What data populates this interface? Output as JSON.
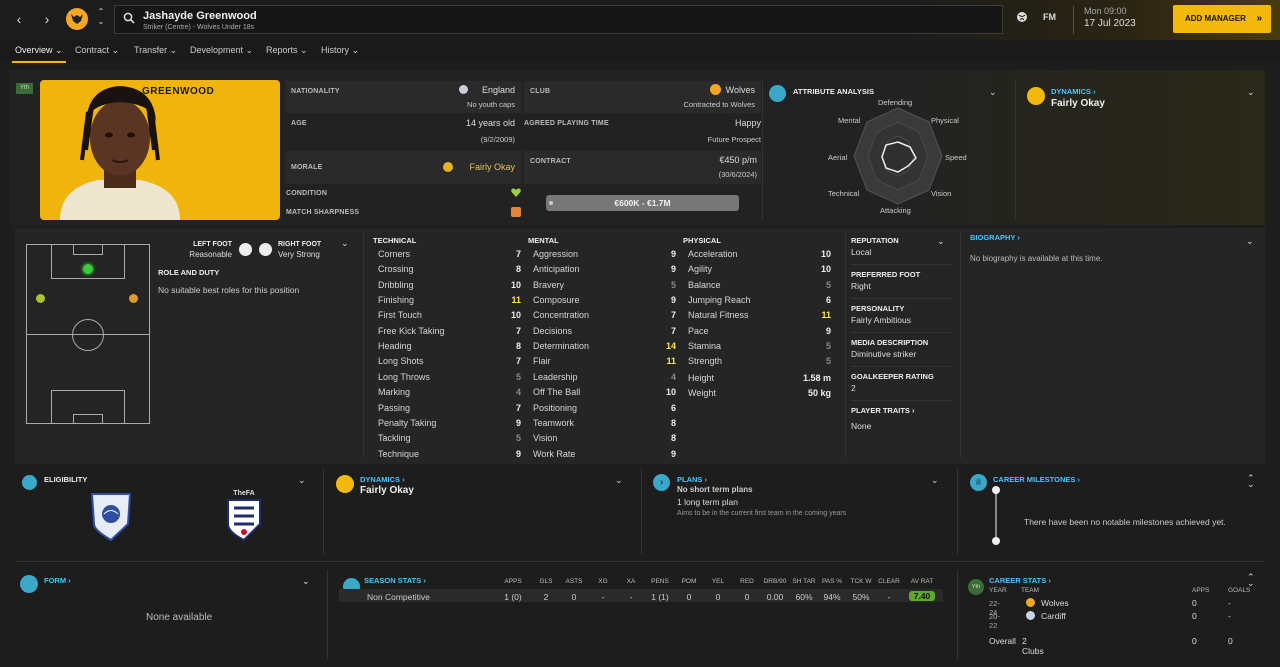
{
  "header": {
    "player_name": "Jashayde Greenwood",
    "player_sub": "Striker (Centre) - Wolves Under 18s",
    "fm_label": "FM",
    "date_time": "Mon 09:00",
    "date": "17 Jul 2023",
    "add_manager": "ADD MANAGER"
  },
  "tabs": [
    {
      "label": "Overview ⌄"
    },
    {
      "label": "Contract ⌄"
    },
    {
      "label": "Transfer ⌄"
    },
    {
      "label": "Development ⌄"
    },
    {
      "label": "Reports ⌄"
    },
    {
      "label": "History ⌄"
    }
  ],
  "profile": {
    "badge": "Yth",
    "surname": "GREENWOOD",
    "nationality_label": "NATIONALITY",
    "nationality": "England",
    "youth_caps": "No youth caps",
    "age_label": "AGE",
    "age": "14 years old",
    "dob": "(9/2/2009)",
    "morale_label": "MORALE",
    "morale": "Fairly Okay",
    "club_label": "CLUB",
    "club": "Wolves",
    "contracted": "Contracted to Wolves",
    "apt_label": "AGREED PLAYING TIME",
    "apt": "Happy",
    "apt_sub": "Future Prospect",
    "contract_label": "CONTRACT",
    "wage": "€450 p/m",
    "contract_end": "(30/6/2024)",
    "condition_label": "CONDITION",
    "sharpness_label": "MATCH SHARPNESS",
    "value": "€600K - €1.7M"
  },
  "attr_analysis": {
    "title": "ATTRIBUTE ANALYSIS",
    "labels": [
      "Defending",
      "Physical",
      "Speed",
      "Vision",
      "Attacking",
      "Technical",
      "Aerial",
      "Mental"
    ]
  },
  "dynamics_top": {
    "title": "DYNAMICS",
    "value": "Fairly Okay"
  },
  "pitch": {
    "left_foot_label": "LEFT FOOT",
    "left_foot": "Reasonable",
    "right_foot_label": "RIGHT FOOT",
    "right_foot": "Very Strong",
    "role_title": "ROLE AND DUTY",
    "role_text": "No suitable best roles for this position"
  },
  "technical": {
    "title": "TECHNICAL",
    "rows": [
      [
        "Corners",
        "7",
        "w"
      ],
      [
        "Crossing",
        "8",
        "w"
      ],
      [
        "Dribbling",
        "10",
        "w"
      ],
      [
        "Finishing",
        "11",
        "y"
      ],
      [
        "First Touch",
        "10",
        "w"
      ],
      [
        "Free Kick Taking",
        "7",
        "w"
      ],
      [
        "Heading",
        "8",
        "w"
      ],
      [
        "Long Shots",
        "7",
        "w"
      ],
      [
        "Long Throws",
        "5",
        "d"
      ],
      [
        "Marking",
        "4",
        "d"
      ],
      [
        "Passing",
        "7",
        "w"
      ],
      [
        "Penalty Taking",
        "9",
        "w"
      ],
      [
        "Tackling",
        "5",
        "d"
      ],
      [
        "Technique",
        "9",
        "w"
      ]
    ]
  },
  "mental": {
    "title": "MENTAL",
    "rows": [
      [
        "Aggression",
        "9",
        "w"
      ],
      [
        "Anticipation",
        "9",
        "w"
      ],
      [
        "Bravery",
        "5",
        "d"
      ],
      [
        "Composure",
        "9",
        "w"
      ],
      [
        "Concentration",
        "7",
        "w"
      ],
      [
        "Decisions",
        "7",
        "w"
      ],
      [
        "Determination",
        "14",
        "y"
      ],
      [
        "Flair",
        "11",
        "y"
      ],
      [
        "Leadership",
        "4",
        "d"
      ],
      [
        "Off The Ball",
        "10",
        "w"
      ],
      [
        "Positioning",
        "6",
        "w"
      ],
      [
        "Teamwork",
        "8",
        "w"
      ],
      [
        "Vision",
        "8",
        "w"
      ],
      [
        "Work Rate",
        "9",
        "w"
      ]
    ]
  },
  "physical": {
    "title": "PHYSICAL",
    "rows": [
      [
        "Acceleration",
        "10",
        "w"
      ],
      [
        "Agility",
        "10",
        "w"
      ],
      [
        "Balance",
        "5",
        "d"
      ],
      [
        "Jumping Reach",
        "6",
        "w"
      ],
      [
        "Natural Fitness",
        "11",
        "y"
      ],
      [
        "Pace",
        "9",
        "w"
      ],
      [
        "Stamina",
        "5",
        "d"
      ],
      [
        "Strength",
        "5",
        "d"
      ]
    ],
    "height_label": "Height",
    "height": "1.58 m",
    "weight_label": "Weight",
    "weight": "50 kg"
  },
  "info": {
    "reputation_label": "REPUTATION",
    "reputation": "Local",
    "pref_foot_label": "PREFERRED FOOT",
    "pref_foot": "Right",
    "personality_label": "PERSONALITY",
    "personality": "Fairly Ambitious",
    "media_label": "MEDIA DESCRIPTION",
    "media": "Diminutive striker",
    "gk_label": "GOALKEEPER RATING",
    "gk": "2",
    "traits_label": "PLAYER TRAITS",
    "traits": "None"
  },
  "biography": {
    "title": "BIOGRAPHY",
    "text": "No biography is available at this time."
  },
  "eligibility": {
    "title": "ELIGIBILITY",
    "fa_text": "TheFA"
  },
  "dynamics_mid": {
    "title": "DYNAMICS",
    "value": "Fairly Okay"
  },
  "plans": {
    "title": "PLANS",
    "short": "No short term plans",
    "long": "1 long term plan",
    "long_sub": "Aims to be in the current first team in the coming years"
  },
  "milestones": {
    "title": "CAREER MILESTONES",
    "text": "There have been no notable milestones achieved yet."
  },
  "form": {
    "title": "FORM",
    "text": "None available"
  },
  "season": {
    "title": "SEASON STATS",
    "headers": [
      "APPS",
      "GLS",
      "ASTS",
      "XG",
      "XA",
      "PENS",
      "POM",
      "YEL",
      "RED",
      "DRB/90",
      "SH TAR",
      "PAS %",
      "TCK W",
      "CLEAR",
      "AV RAT"
    ],
    "row_label": "Non Competitive",
    "values": [
      "1 (0)",
      "2",
      "0",
      "-",
      "-",
      "1 (1)",
      "0",
      "0",
      "0",
      "0.00",
      "60%",
      "94%",
      "50%",
      "-",
      "7.40"
    ]
  },
  "career": {
    "title": "CAREER STATS",
    "badge": "Yth",
    "col_year": "YEAR",
    "col_team": "TEAM",
    "col_apps": "APPS",
    "col_goals": "GOALS",
    "rows": [
      {
        "year": "22-24",
        "team": "Wolves",
        "apps": "0",
        "goals": "-"
      },
      {
        "year": "20-22",
        "team": "Cardiff",
        "apps": "0",
        "goals": "-"
      }
    ],
    "overall_label": "Overall",
    "overall_clubs": "2 Clubs",
    "overall_apps": "0",
    "overall_goals": "0"
  },
  "colors": {
    "accent": "#f2b90c",
    "link": "#4cc3ff",
    "highlight": "#ffe54c",
    "rating": "#5fa829"
  }
}
